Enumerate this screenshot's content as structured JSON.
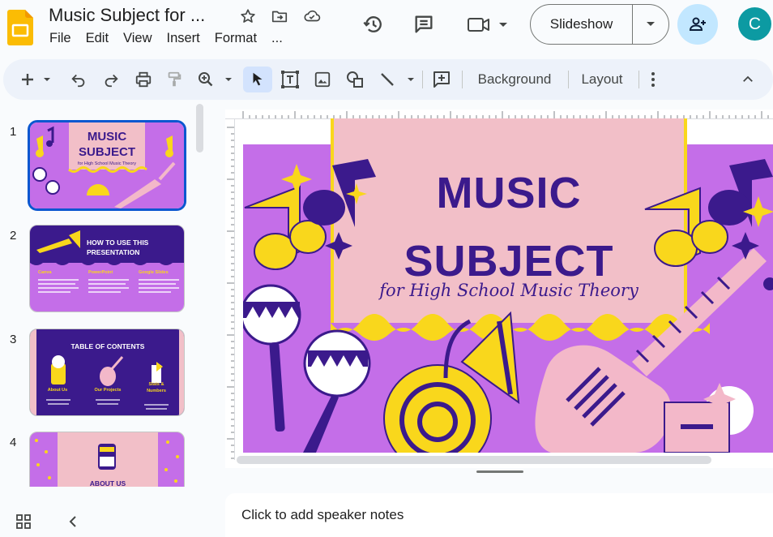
{
  "app": {
    "doc_title": "Music Subject for ...",
    "icons": {
      "logo": "slides-logo-icon",
      "star": "star-icon",
      "move": "move-to-folder-icon",
      "cloud": "cloud-saved-icon",
      "history": "version-history-icon",
      "comments": "comments-icon",
      "meet": "meet-camera-icon"
    }
  },
  "menu": [
    "File",
    "Edit",
    "View",
    "Insert",
    "Format",
    "..."
  ],
  "header": {
    "slideshow_label": "Slideshow",
    "avatar_letter": "C",
    "share_color": "#c2e7ff",
    "avatar_color": "#0c9aa2"
  },
  "toolbar": {
    "background_label": "Background",
    "layout_label": "Layout"
  },
  "filmstrip": {
    "slides": [
      {
        "num": "1",
        "title_line1": "MUSIC",
        "title_line2": "SUBJECT",
        "subtitle": "for High School Music Theory"
      },
      {
        "num": "2",
        "title_line1": "HOW TO USE THIS",
        "title_line2": "PRESENTATION",
        "col1": "Canva",
        "col2": "PowerPoint",
        "col3": "Google Slides"
      },
      {
        "num": "3",
        "title": "TABLE OF CONTENTS",
        "item1": "About Us",
        "item2": "Our Projects",
        "item3": "Stats &",
        "item3b": "Numbers"
      },
      {
        "num": "4",
        "title": "ABOUT US"
      }
    ]
  },
  "slide": {
    "title_line1": "MUSIC",
    "title_line2": "SUBJECT",
    "subtitle": "for High School Music Theory",
    "colors": {
      "background": "#c46ee8",
      "banner": "#f2bfc8",
      "navy": "#3b1a8c",
      "yellow": "#f9d71c",
      "pink": "#f3b8c9"
    }
  },
  "notes": {
    "placeholder": "Click to add speaker notes"
  }
}
